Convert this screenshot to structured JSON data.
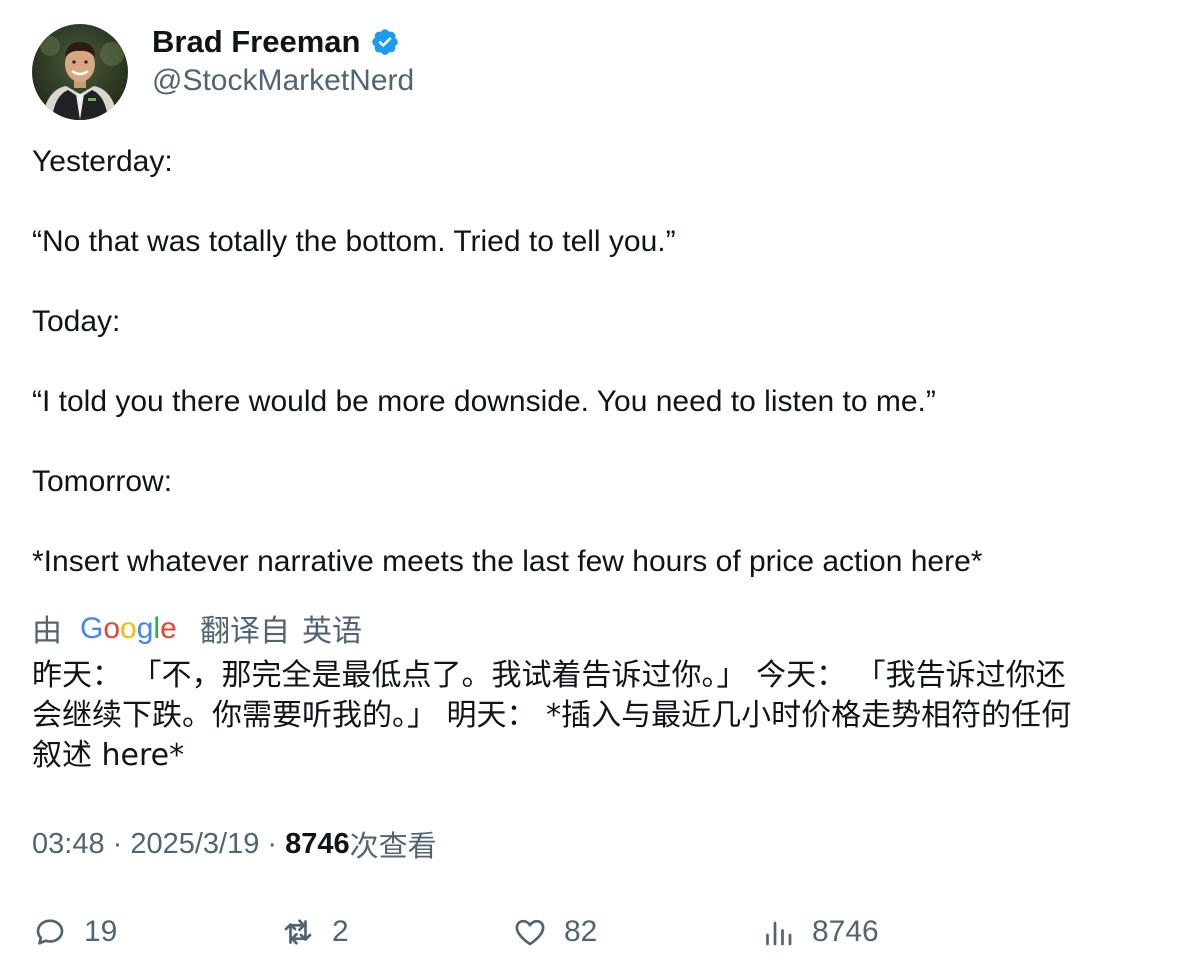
{
  "author": {
    "display_name": "Brad Freeman",
    "handle": "@StockMarketNerd",
    "verified": true,
    "verified_color": "#1d9bf0"
  },
  "tweet": {
    "paragraphs": [
      "Yesterday:",
      "“No that was totally the bottom. Tried to tell you.”",
      "Today:",
      "“I told you there would be more downside. You need to listen to me.”",
      "Tomorrow:",
      "*Insert whatever narrative meets the last few hours of price action here*"
    ]
  },
  "translation": {
    "prefix": "由",
    "provider": "Google",
    "suffix": "翻译自",
    "language": "英语",
    "lines": [
      "昨天： 「不，那完全是最低点了。我试着告诉过你。」 今天： 「我告诉过你还",
      "会继续下跌。你需要听我的。」 明天： *插入与最近几小时价格走势相符的任何",
      "叙述 here*"
    ]
  },
  "meta": {
    "time": "03:48",
    "separator": " · ",
    "date": "2025/3/19",
    "views_count": "8746",
    "views_label": "次查看"
  },
  "actions": {
    "reply_count": "19",
    "retweet_count": "2",
    "like_count": "82",
    "views_count": "8746"
  },
  "colors": {
    "text_primary": "#0f1419",
    "text_secondary": "#536471",
    "google_blue": "#4285f4",
    "google_red": "#ea4335",
    "google_yellow": "#fbbc05",
    "google_green": "#34a853"
  }
}
